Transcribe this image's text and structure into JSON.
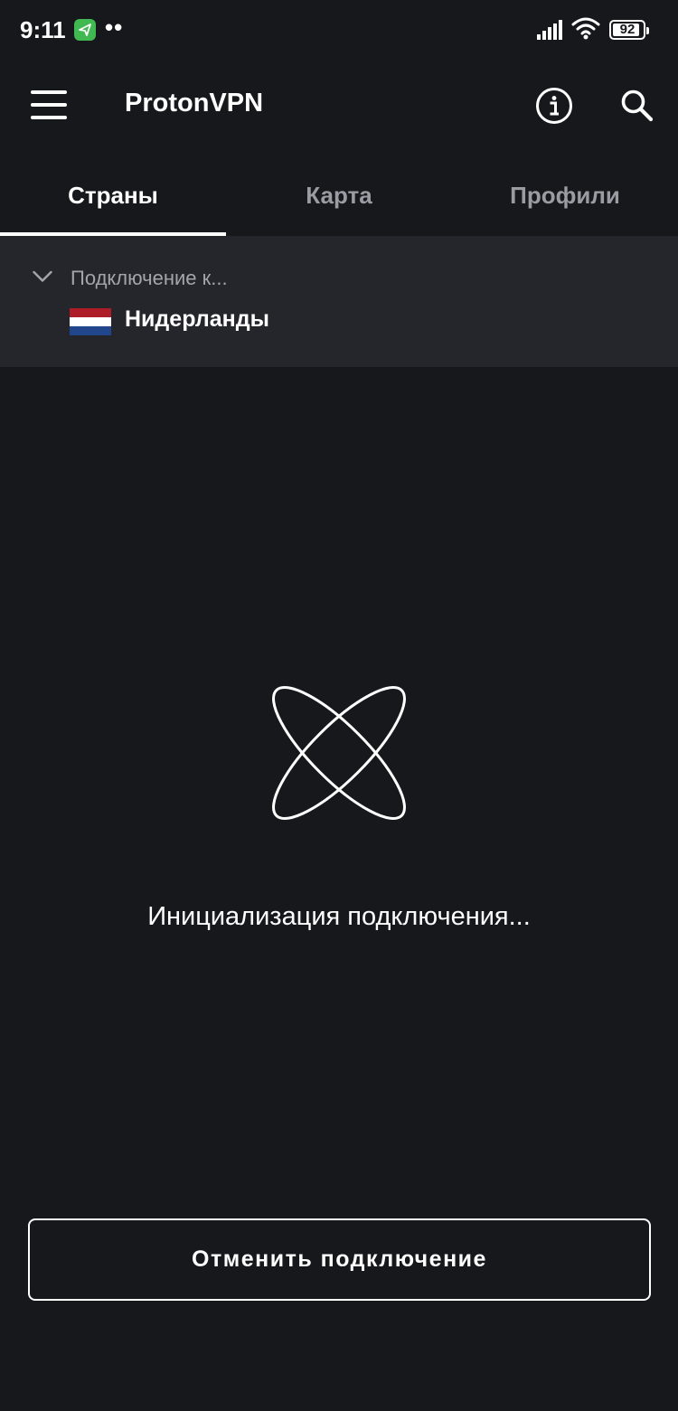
{
  "status_bar": {
    "time": "9:11",
    "dots": "••",
    "battery_level": "92",
    "battery_fraction": 0.92
  },
  "app_bar": {
    "title": "ProtonVPN",
    "menu_icon": "menu-icon",
    "info_icon": "info-icon",
    "search_icon": "search-icon"
  },
  "tabs": [
    {
      "label": "Страны",
      "active": true
    },
    {
      "label": "Карта",
      "active": false
    },
    {
      "label": "Профили",
      "active": false
    }
  ],
  "connection": {
    "label": "Подключение к...",
    "country": "Нидерланды",
    "flag_colors": [
      "#ae1c28",
      "#ffffff",
      "#21468b"
    ]
  },
  "main": {
    "status_message": "Инициализация подключения...",
    "loader_icon": "atom-loader-icon"
  },
  "actions": {
    "cancel_label": "Отменить подключение"
  },
  "colors": {
    "background": "#17181c",
    "panel": "#25262b",
    "text_primary": "#ffffff",
    "text_secondary": "#9b9ca3"
  }
}
